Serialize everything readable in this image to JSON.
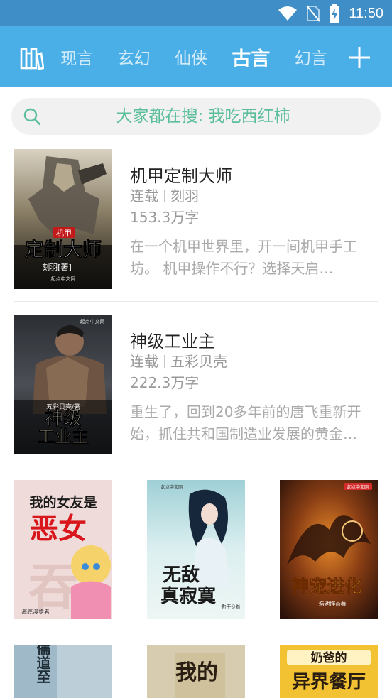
{
  "status_bar": {
    "time": "11:50",
    "icons": [
      "wifi-icon",
      "no-sim-icon",
      "battery-charging-icon"
    ]
  },
  "top_bar": {
    "left_icon": "bookshelf-icon",
    "tabs": [
      {
        "label": "现言",
        "active": false
      },
      {
        "label": "玄幻",
        "active": false
      },
      {
        "label": "仙侠",
        "active": false
      },
      {
        "label": "古言",
        "active": true
      },
      {
        "label": "幻言",
        "active": false
      }
    ],
    "right_icon": "plus-icon"
  },
  "search": {
    "text": "大家都在搜: 我吃西红柿",
    "icon": "search-icon"
  },
  "books": [
    {
      "title": "机甲定制大师",
      "status": "连载",
      "author": "刻羽",
      "words": "153.3万字",
      "description": "在一个机甲世界里，开一间机甲手工坊。        机甲操作不行？选择天启…",
      "cover": {
        "tag": "机甲",
        "title": "定制大师",
        "author_line": "刻羽[著]",
        "publisher": "起点中文网"
      }
    },
    {
      "title": "神级工业主",
      "status": "连载",
      "author": "五彩贝壳",
      "words": "222.3万字",
      "description": "重生了，回到20多年前的唐飞重新开始，抓住共和国制造业发展的黄金…",
      "cover": {
        "title_top": "神级",
        "title_bottom": "工业主",
        "author_line": "五彩贝壳/著",
        "publisher": "起点中文网"
      }
    }
  ],
  "grid_covers": [
    {
      "title_top": "我的女友是",
      "title_big": "恶女",
      "author_line": "海底漫步者"
    },
    {
      "title_top": "无敌",
      "title_bottom": "真寂寞",
      "author_line": "新丰◎著",
      "publisher": "起点中文网"
    },
    {
      "title": "神宠进化",
      "author_line": "浩池胖◎著",
      "publisher": "起点中文网"
    },
    {
      "title": "儒道至"
    },
    {
      "title": "我的"
    },
    {
      "title_top": "奶爸的",
      "title_bottom": "异界餐厅"
    }
  ],
  "colors": {
    "status_bar": "#3f8ec7",
    "top_bar": "#4aaee7",
    "search_text": "#5bbe9a",
    "meta_text": "#999999"
  }
}
